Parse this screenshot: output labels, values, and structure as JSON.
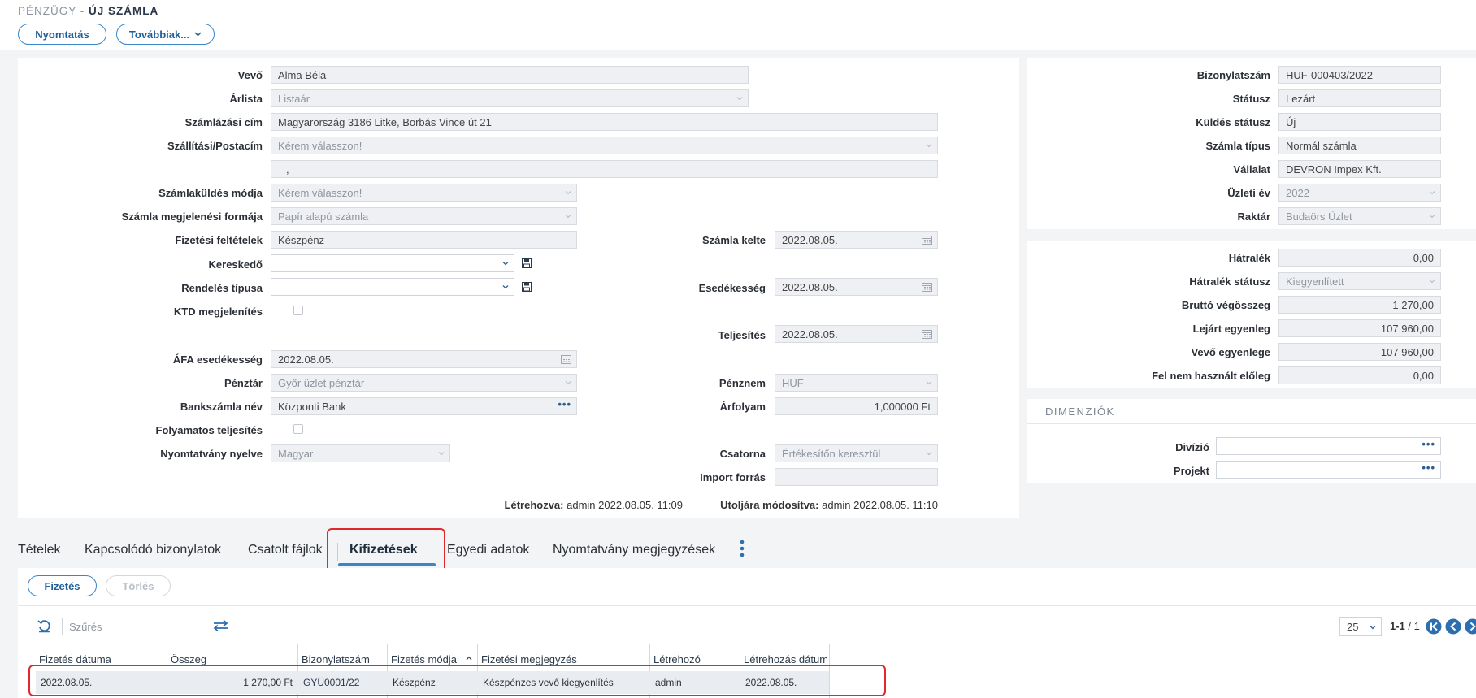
{
  "breadcrumb": {
    "section": "PÉNZÜGY -",
    "page": "ÚJ SZÁMLA"
  },
  "toolbar": {
    "print_label": "Nyomtatás",
    "more_label": "Továbbiak..."
  },
  "form": {
    "vevo": {
      "label": "Vevő",
      "value": "Alma Béla"
    },
    "arlista": {
      "label": "Árlista",
      "value": "Listaár"
    },
    "szamlazasi_cim": {
      "label": "Számlázási cím",
      "value": "Magyarország 3186 Litke, Borbás Vince út 21"
    },
    "szallitasi": {
      "label": "Szállítási/Postacím",
      "value": "Kérem válasszon!",
      "extra": ","
    },
    "kuldes_modja": {
      "label": "Számlaküldés módja",
      "value": "Kérem válasszon!"
    },
    "megjelenesi_forma": {
      "label": "Számla megjelenési formája",
      "value": "Papír alapú számla"
    },
    "fizetesi_feltetelek": {
      "label": "Fizetési feltételek",
      "value": "Készpénz"
    },
    "kereskedo": {
      "label": "Kereskedő",
      "value": ""
    },
    "rendeles_tipusa": {
      "label": "Rendelés típusa",
      "value": ""
    },
    "ktd": {
      "label": "KTD megjelenítés"
    },
    "afa_esedekesseg": {
      "label": "ÁFA esedékesség",
      "value": "2022.08.05."
    },
    "penztar": {
      "label": "Pénztár",
      "value": "Győr üzlet pénztár"
    },
    "bankszamla": {
      "label": "Bankszámla név",
      "value": "Központi Bank"
    },
    "folyamatos": {
      "label": "Folyamatos teljesítés"
    },
    "nyomtatvany_nyelve": {
      "label": "Nyomtatvány nyelve",
      "value": "Magyar"
    },
    "szamla_kelte": {
      "label": "Számla kelte",
      "value": "2022.08.05."
    },
    "esedekesseg": {
      "label": "Esedékesség",
      "value": "2022.08.05."
    },
    "teljesites": {
      "label": "Teljesítés",
      "value": "2022.08.05."
    },
    "penznem": {
      "label": "Pénznem",
      "value": "HUF"
    },
    "arfolyam": {
      "label": "Árfolyam",
      "value": "1,000000 Ft"
    },
    "csatorna": {
      "label": "Csatorna",
      "value": "Értékesítőn keresztül"
    },
    "import_forras": {
      "label": "Import forrás",
      "value": ""
    },
    "letrehozva_label": "Létrehozva:",
    "letrehozva_value": "admin 2022.08.05. 11:09",
    "modositva_label": "Utoljára módosítva:",
    "modositva_value": "admin 2022.08.05. 11:10"
  },
  "doc_info": {
    "bizonylatszam": {
      "label": "Bizonylatszám",
      "value": "HUF-000403/2022"
    },
    "statusz": {
      "label": "Státusz",
      "value": "Lezárt"
    },
    "kuldes_statusz": {
      "label": "Küldés státusz",
      "value": "Új"
    },
    "szamla_tipus": {
      "label": "Számla típus",
      "value": "Normál számla"
    },
    "vallalat": {
      "label": "Vállalat",
      "value": "DEVRON Impex Kft."
    },
    "uzleti_ev": {
      "label": "Üzleti év",
      "value": "2022"
    },
    "raktar": {
      "label": "Raktár",
      "value": "Budaörs Üzlet"
    }
  },
  "balance": {
    "hatralek": {
      "label": "Hátralék",
      "value": "0,00"
    },
    "hatralek_statusz": {
      "label": "Hátralék státusz",
      "value": "Kiegyenlített"
    },
    "brutto": {
      "label": "Bruttó végösszeg",
      "value": "1 270,00"
    },
    "lejart": {
      "label": "Lejárt egyenleg",
      "value": "107 960,00"
    },
    "vevo_egyenlege": {
      "label": "Vevő egyenlege",
      "value": "107 960,00"
    },
    "eloleg": {
      "label": "Fel nem használt előleg",
      "value": "0,00"
    }
  },
  "dimensions": {
    "title": "DIMENZIÓK",
    "divizio": {
      "label": "Divízió",
      "value": ""
    },
    "projekt": {
      "label": "Projekt",
      "value": ""
    }
  },
  "tabs": [
    "Tételek",
    "Kapcsolódó bizonylatok",
    "Csatolt fájlok",
    "Kifizetések",
    "Egyedi adatok",
    "Nyomtatvány megjegyzések"
  ],
  "payments": {
    "pay_button": "Fizetés",
    "delete_button": "Törlés",
    "filter_placeholder": "Szűrés",
    "page_size": "25",
    "pager_text": "1-1",
    "pager_total": "/ 1",
    "columns": [
      "Fizetés dátuma",
      "Összeg",
      "Bizonylatszám",
      "Fizetés módja",
      "Fizetési megjegyzés",
      "Létrehozó",
      "Létrehozás dátum"
    ],
    "rows": [
      [
        "2022.08.05.",
        "1 270,00 Ft",
        "GYÜ0001/22",
        "Készpénz",
        "Készpénzes vevő kiegyenlítés",
        "admin",
        "2022.08.05."
      ]
    ]
  }
}
